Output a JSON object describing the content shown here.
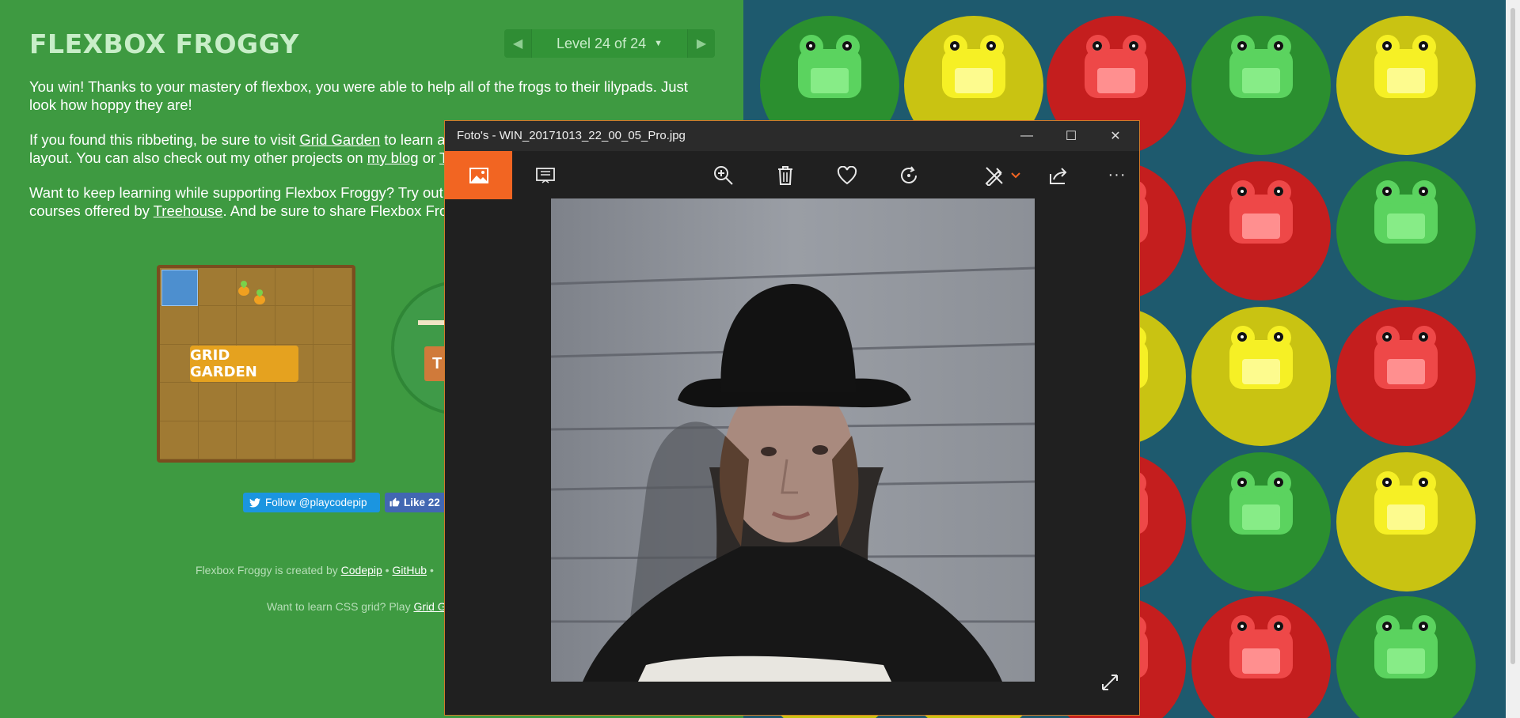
{
  "game": {
    "title": "FLEXBOX FROGGY",
    "level_label": "Level 24 of 24",
    "prev_arrow": "◀",
    "next_arrow": "▶",
    "level_caret": "▼",
    "p1": "You win! Thanks to your mastery of flexbox, you were able to help all of the frogs to their lilypads. Just look how hoppy they are!",
    "p2_pre": "If you found this ribbeting, be sure to visit ",
    "p2_link_garden": "Grid Garden",
    "p2_mid": " to learn ab",
    "p2_line2_pre": "layout. You can also check out my other projects on ",
    "p2_link_blog": "my blog",
    "p2_or": " or ",
    "p2_link_tw": "Tw",
    "p3_pre": "Want to keep learning while supporting Flexbox Froggy? Try out t",
    "p3_line2_pre": "courses offered by ",
    "p3_link_treehouse": "Treehouse",
    "p3_line2_post": ". And be sure to share Flexbox Frogg",
    "garden_button": "GRID GARDEN",
    "treehouse_letter": "T",
    "twitter_button": "Follow @playcodepip",
    "facebook_button": "Like 22",
    "footer1_pre": "Flexbox Froggy is created by ",
    "footer1_codepip": "Codepip",
    "footer1_sep": " • ",
    "footer1_github": "GitHub",
    "footer1_sep2": " •",
    "footer2_pre": "Want to learn CSS grid? Play ",
    "footer2_link": "Grid G"
  },
  "photos_window": {
    "title": "Foto's - WIN_20171013_22_00_05_Pro.jpg",
    "minimize": "—",
    "maximize": "☐",
    "close": "✕",
    "toolbar": {
      "collection_icon": "image-icon",
      "slideshow_icon": "slideshow-icon",
      "zoom_icon": "zoom-in-icon",
      "delete_icon": "trash-icon",
      "favorite_icon": "heart-icon",
      "rotate_icon": "rotate-icon",
      "edit_icon": "edit-create-icon",
      "share_icon": "share-icon",
      "more_label": "···"
    },
    "expand_icon": "expand-icon"
  },
  "colors": {
    "game_bg": "#3e9a41",
    "pond_bg": "#1e5a6e",
    "photos_accent": "#f26522",
    "frog_green": "#5bd35f",
    "frog_yellow": "#f6f025",
    "frog_red": "#ee4848"
  }
}
